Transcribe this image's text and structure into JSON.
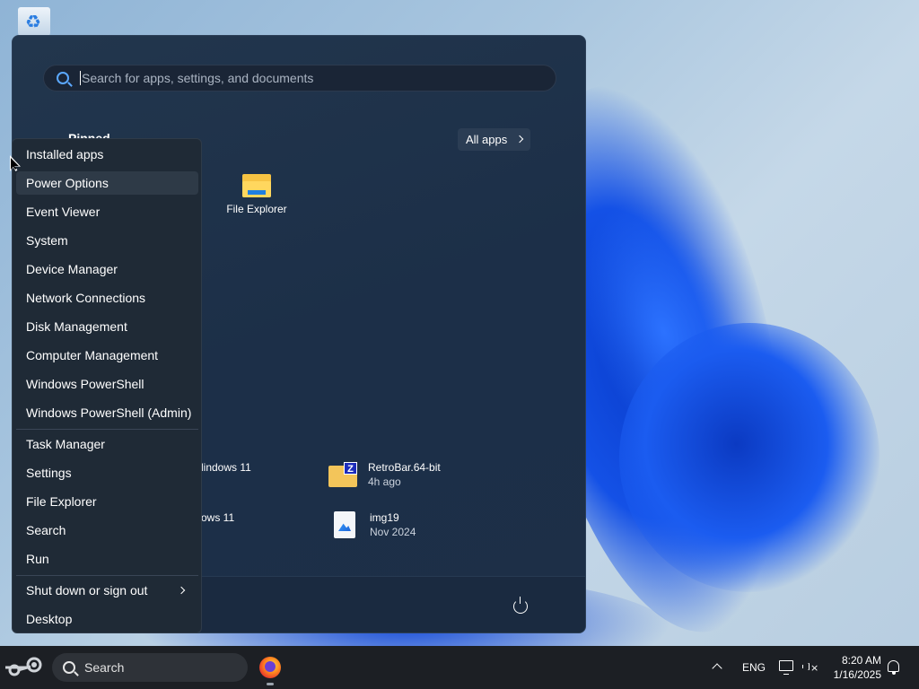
{
  "start_menu": {
    "search_placeholder": "Search for apps, settings, and documents",
    "pinned_heading": "Pinned",
    "all_apps_label": "All apps",
    "pinned_apps": [
      {
        "label": "File Explorer",
        "icon": "folder-icon"
      }
    ],
    "recommended": [
      {
        "title": "lindows 11",
        "subtitle": ""
      },
      {
        "title": "ows 11",
        "subtitle": ""
      },
      {
        "title": "RetroBar.64-bit",
        "subtitle": "4h ago",
        "icon": "zip-folder-icon"
      },
      {
        "title": "img19",
        "subtitle": "Nov 2024",
        "icon": "image-file-icon"
      }
    ],
    "power_icon": "power-icon"
  },
  "context_menu": {
    "items": [
      "Installed apps",
      "Power Options",
      "Event Viewer",
      "System",
      "Device Manager",
      "Network Connections",
      "Disk Management",
      "Computer Management",
      "Windows PowerShell",
      "Windows PowerShell (Admin)",
      "Task Manager",
      "Settings",
      "File Explorer",
      "Search",
      "Run",
      "Shut down or sign out",
      "Desktop"
    ],
    "hovered_item": "Power Options"
  },
  "taskbar": {
    "search_label": "Search",
    "language": "ENG",
    "time": "8:20 AM",
    "date": "1/16/2025"
  },
  "desktop": {
    "icons": [
      "recycle-bin-icon"
    ]
  },
  "colors": {
    "accent": "#5ba8ff",
    "menu_bg": "#1f2a36",
    "start_bg": "#1c2f48",
    "taskbar_bg": "#1c1f24",
    "wallpaper_bloom": "#1451e6"
  }
}
